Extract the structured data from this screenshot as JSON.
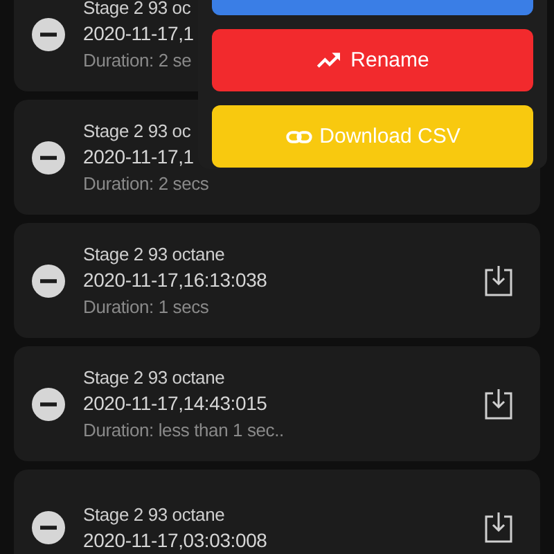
{
  "sessions": [
    {
      "title": "Stage 2 93 oc",
      "timestamp": "2020-11-17,1",
      "duration": "Duration: 2 se"
    },
    {
      "title": "Stage 2 93 oc",
      "timestamp": "2020-11-17,1",
      "duration": "Duration: 2 secs"
    },
    {
      "title": "Stage 2 93 octane",
      "timestamp": "2020-11-17,16:13:038",
      "duration": "Duration: 1 secs"
    },
    {
      "title": "Stage 2 93 octane",
      "timestamp": "2020-11-17,14:43:015",
      "duration": "Duration: less than 1 sec.."
    },
    {
      "title": "Stage 2 93 octane",
      "timestamp": "2020-11-17,03:03:008"
    }
  ],
  "menu": {
    "actions": [
      {
        "kind": "primary"
      },
      {
        "kind": "danger",
        "label": "Rename"
      },
      {
        "kind": "warning",
        "label": "Download CSV"
      }
    ]
  }
}
